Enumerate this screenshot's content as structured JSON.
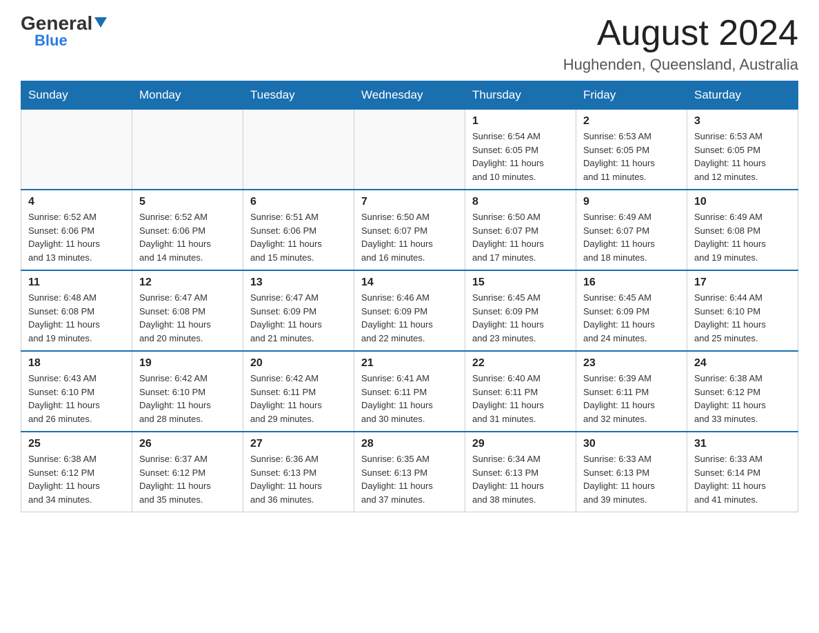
{
  "header": {
    "logo_general": "General",
    "logo_blue": "Blue",
    "month_title": "August 2024",
    "subtitle": "Hughenden, Queensland, Australia"
  },
  "days_of_week": [
    "Sunday",
    "Monday",
    "Tuesday",
    "Wednesday",
    "Thursday",
    "Friday",
    "Saturday"
  ],
  "weeks": [
    [
      {
        "day": "",
        "info": ""
      },
      {
        "day": "",
        "info": ""
      },
      {
        "day": "",
        "info": ""
      },
      {
        "day": "",
        "info": ""
      },
      {
        "day": "1",
        "info": "Sunrise: 6:54 AM\nSunset: 6:05 PM\nDaylight: 11 hours\nand 10 minutes."
      },
      {
        "day": "2",
        "info": "Sunrise: 6:53 AM\nSunset: 6:05 PM\nDaylight: 11 hours\nand 11 minutes."
      },
      {
        "day": "3",
        "info": "Sunrise: 6:53 AM\nSunset: 6:05 PM\nDaylight: 11 hours\nand 12 minutes."
      }
    ],
    [
      {
        "day": "4",
        "info": "Sunrise: 6:52 AM\nSunset: 6:06 PM\nDaylight: 11 hours\nand 13 minutes."
      },
      {
        "day": "5",
        "info": "Sunrise: 6:52 AM\nSunset: 6:06 PM\nDaylight: 11 hours\nand 14 minutes."
      },
      {
        "day": "6",
        "info": "Sunrise: 6:51 AM\nSunset: 6:06 PM\nDaylight: 11 hours\nand 15 minutes."
      },
      {
        "day": "7",
        "info": "Sunrise: 6:50 AM\nSunset: 6:07 PM\nDaylight: 11 hours\nand 16 minutes."
      },
      {
        "day": "8",
        "info": "Sunrise: 6:50 AM\nSunset: 6:07 PM\nDaylight: 11 hours\nand 17 minutes."
      },
      {
        "day": "9",
        "info": "Sunrise: 6:49 AM\nSunset: 6:07 PM\nDaylight: 11 hours\nand 18 minutes."
      },
      {
        "day": "10",
        "info": "Sunrise: 6:49 AM\nSunset: 6:08 PM\nDaylight: 11 hours\nand 19 minutes."
      }
    ],
    [
      {
        "day": "11",
        "info": "Sunrise: 6:48 AM\nSunset: 6:08 PM\nDaylight: 11 hours\nand 19 minutes."
      },
      {
        "day": "12",
        "info": "Sunrise: 6:47 AM\nSunset: 6:08 PM\nDaylight: 11 hours\nand 20 minutes."
      },
      {
        "day": "13",
        "info": "Sunrise: 6:47 AM\nSunset: 6:09 PM\nDaylight: 11 hours\nand 21 minutes."
      },
      {
        "day": "14",
        "info": "Sunrise: 6:46 AM\nSunset: 6:09 PM\nDaylight: 11 hours\nand 22 minutes."
      },
      {
        "day": "15",
        "info": "Sunrise: 6:45 AM\nSunset: 6:09 PM\nDaylight: 11 hours\nand 23 minutes."
      },
      {
        "day": "16",
        "info": "Sunrise: 6:45 AM\nSunset: 6:09 PM\nDaylight: 11 hours\nand 24 minutes."
      },
      {
        "day": "17",
        "info": "Sunrise: 6:44 AM\nSunset: 6:10 PM\nDaylight: 11 hours\nand 25 minutes."
      }
    ],
    [
      {
        "day": "18",
        "info": "Sunrise: 6:43 AM\nSunset: 6:10 PM\nDaylight: 11 hours\nand 26 minutes."
      },
      {
        "day": "19",
        "info": "Sunrise: 6:42 AM\nSunset: 6:10 PM\nDaylight: 11 hours\nand 28 minutes."
      },
      {
        "day": "20",
        "info": "Sunrise: 6:42 AM\nSunset: 6:11 PM\nDaylight: 11 hours\nand 29 minutes."
      },
      {
        "day": "21",
        "info": "Sunrise: 6:41 AM\nSunset: 6:11 PM\nDaylight: 11 hours\nand 30 minutes."
      },
      {
        "day": "22",
        "info": "Sunrise: 6:40 AM\nSunset: 6:11 PM\nDaylight: 11 hours\nand 31 minutes."
      },
      {
        "day": "23",
        "info": "Sunrise: 6:39 AM\nSunset: 6:11 PM\nDaylight: 11 hours\nand 32 minutes."
      },
      {
        "day": "24",
        "info": "Sunrise: 6:38 AM\nSunset: 6:12 PM\nDaylight: 11 hours\nand 33 minutes."
      }
    ],
    [
      {
        "day": "25",
        "info": "Sunrise: 6:38 AM\nSunset: 6:12 PM\nDaylight: 11 hours\nand 34 minutes."
      },
      {
        "day": "26",
        "info": "Sunrise: 6:37 AM\nSunset: 6:12 PM\nDaylight: 11 hours\nand 35 minutes."
      },
      {
        "day": "27",
        "info": "Sunrise: 6:36 AM\nSunset: 6:13 PM\nDaylight: 11 hours\nand 36 minutes."
      },
      {
        "day": "28",
        "info": "Sunrise: 6:35 AM\nSunset: 6:13 PM\nDaylight: 11 hours\nand 37 minutes."
      },
      {
        "day": "29",
        "info": "Sunrise: 6:34 AM\nSunset: 6:13 PM\nDaylight: 11 hours\nand 38 minutes."
      },
      {
        "day": "30",
        "info": "Sunrise: 6:33 AM\nSunset: 6:13 PM\nDaylight: 11 hours\nand 39 minutes."
      },
      {
        "day": "31",
        "info": "Sunrise: 6:33 AM\nSunset: 6:14 PM\nDaylight: 11 hours\nand 41 minutes."
      }
    ]
  ]
}
